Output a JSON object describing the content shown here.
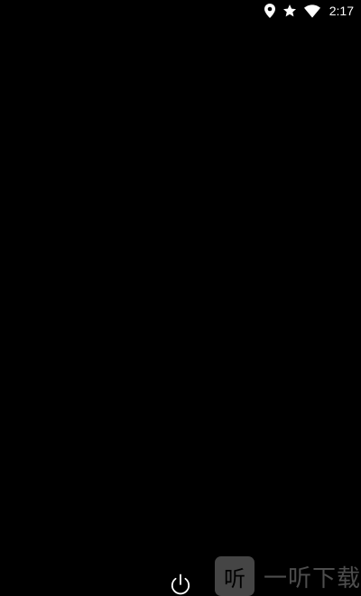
{
  "status_bar": {
    "icons": [
      "location-icon",
      "star-icon",
      "wifi-icon"
    ],
    "time": "2:17"
  },
  "bottom": {
    "power_icon": "power-icon"
  },
  "watermark": {
    "logo_char": "听",
    "text": "一听下载"
  },
  "colors": {
    "background": "#000000",
    "foreground": "#ffffff"
  }
}
